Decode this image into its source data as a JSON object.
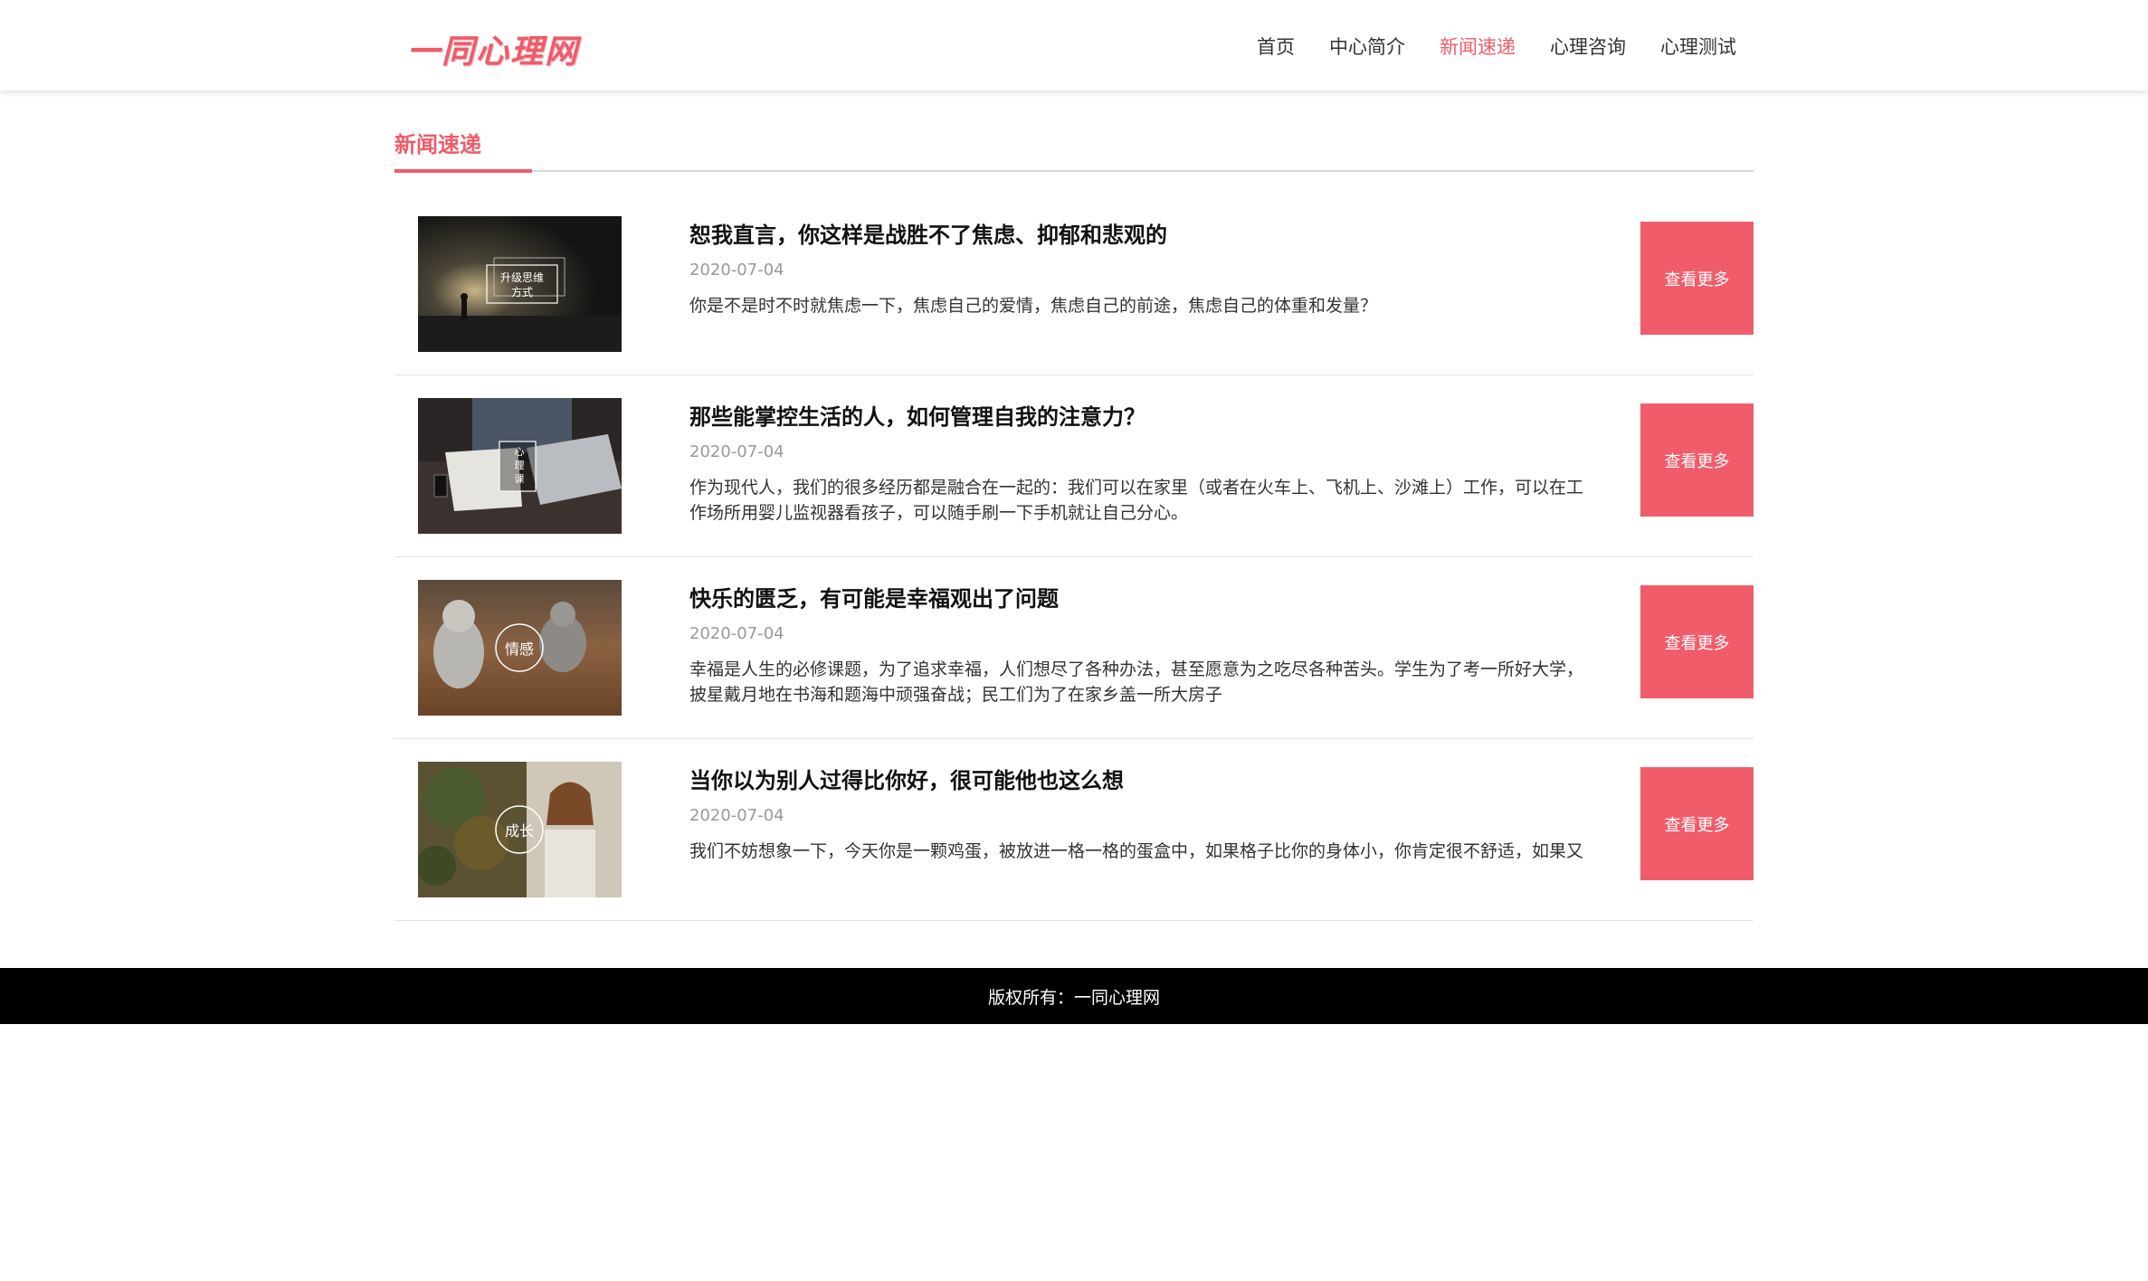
{
  "brand": {
    "logo_text": "一同心理网",
    "accent_color": "#ee5c6a"
  },
  "nav": {
    "items": [
      {
        "label": "首页"
      },
      {
        "label": "中心简介"
      },
      {
        "label": "新闻速递"
      },
      {
        "label": "心理咨询"
      },
      {
        "label": "心理测试"
      }
    ],
    "active_index": 2
  },
  "section": {
    "title": "新闻速递"
  },
  "news": [
    {
      "title": "恕我直言，你这样是战胜不了焦虑、抑郁和悲观的",
      "date": "2020-07-04",
      "summary": "你是不是时不时就焦虑一下，焦虑自己的爱情，焦虑自己的前途，焦虑自己的体重和发量？",
      "thumb_caption": "升级思维 方式",
      "more_label": "查看更多"
    },
    {
      "title": "那些能掌控生活的人，如何管理自我的注意力？",
      "date": "2020-07-04",
      "summary": "作为现代人，我们的很多经历都是融合在一起的：我们可以在家里（或者在火车上、飞机上、沙滩上）工作，可以在工作场所用婴儿监视器看孩子，可以随手刷一下手机就让自己分心。",
      "thumb_caption": "心理课",
      "more_label": "查看更多"
    },
    {
      "title": "快乐的匮乏，有可能是幸福观出了问题",
      "date": "2020-07-04",
      "summary": "幸福是人生的必修课题，为了追求幸福，人们想尽了各种办法，甚至愿意为之吃尽各种苦头。学生为了考一所好大学，披星戴月地在书海和题海中顽强奋战；民工们为了在家乡盖一所大房子",
      "thumb_caption": "情感",
      "more_label": "查看更多"
    },
    {
      "title": "当你以为别人过得比你好，很可能他也这么想",
      "date": "2020-07-04",
      "summary": "我们不妨想象一下，今天你是一颗鸡蛋，被放进一格一格的蛋盒中，如果格子比你的身体小，你肯定很不舒适，如果又",
      "thumb_caption": "成长",
      "more_label": "查看更多"
    }
  ],
  "footer": {
    "text": "版权所有：一同心理网"
  }
}
